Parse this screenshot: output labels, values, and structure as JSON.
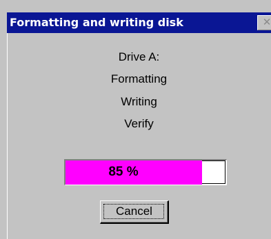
{
  "window": {
    "title": "Formatting and writing disk",
    "close_glyph": "✕"
  },
  "status": {
    "drive": "Drive A:",
    "step1": "Formatting",
    "step2": "Writing",
    "step3": "Verify"
  },
  "progress": {
    "value": 85,
    "label": "85 %",
    "fill_color": "#ff00ff"
  },
  "buttons": {
    "cancel_label": "Cancel"
  },
  "colors": {
    "titlebar": "#0a1694",
    "dialog_bg": "#c3c3c3"
  }
}
